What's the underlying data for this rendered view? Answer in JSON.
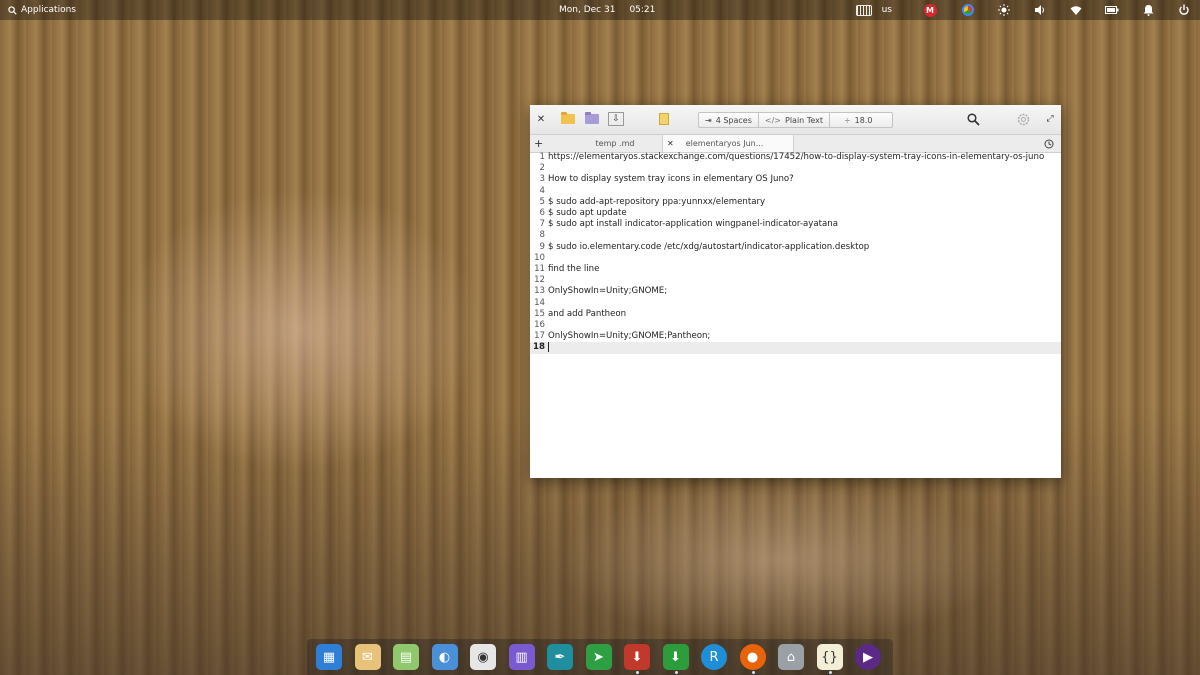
{
  "panel": {
    "applications_label": "Applications",
    "date": "Mon, Dec 31",
    "time": "05:21",
    "keyboard_layout": "us",
    "tray_icons": [
      "keyboard-icon",
      "mega-icon",
      "chrome-icon",
      "brightness-icon",
      "volume-icon",
      "wifi-icon",
      "battery-icon",
      "notifications-icon",
      "power-icon"
    ],
    "mega_letter": "M"
  },
  "editor": {
    "toolbar": {
      "indent_label": "4 Spaces",
      "language_label": "Plain Text",
      "font_size": "18.0"
    },
    "tabs": [
      {
        "label": "temp .md"
      },
      {
        "label": "elementaryos Jun..."
      }
    ],
    "current_line": "18",
    "lines": [
      {
        "n": "1",
        "text": "https://elementaryos.stackexchange.com/questions/17452/how-to-display-system-tray-icons-in-elementary-os-juno"
      },
      {
        "n": "2",
        "text": ""
      },
      {
        "n": "3",
        "text": "How to display system tray icons in elementary OS Juno?"
      },
      {
        "n": "4",
        "text": ""
      },
      {
        "n": "5",
        "text": "$ sudo add-apt-repository ppa:yunnxx/elementary"
      },
      {
        "n": "6",
        "text": "$ sudo apt update"
      },
      {
        "n": "7",
        "text": "$ sudo apt install indicator-application wingpanel-indicator-ayatana"
      },
      {
        "n": "8",
        "text": ""
      },
      {
        "n": "9",
        "text": "$ sudo io.elementary.code /etc/xdg/autostart/indicator-application.desktop"
      },
      {
        "n": "10",
        "text": ""
      },
      {
        "n": "11",
        "text": "find the line"
      },
      {
        "n": "12",
        "text": ""
      },
      {
        "n": "13",
        "text": "OnlyShowIn=Unity;GNOME;"
      },
      {
        "n": "14",
        "text": ""
      },
      {
        "n": "15",
        "text": "and add Pantheon"
      },
      {
        "n": "16",
        "text": ""
      },
      {
        "n": "17",
        "text": "OnlyShowIn=Unity;GNOME;Pantheon;"
      }
    ]
  },
  "dock": {
    "apps": [
      {
        "name": "multitasking-view-icon",
        "color": "#2f7fd6",
        "running": false
      },
      {
        "name": "mail-icon",
        "color": "#e9c27a",
        "running": false
      },
      {
        "name": "calendar-icon",
        "color": "#8fc96b",
        "running": false
      },
      {
        "name": "settings-toggle-icon",
        "color": "#4a90d9",
        "running": false
      },
      {
        "name": "music-player-icon",
        "color": "#e6e6e6",
        "running": false
      },
      {
        "name": "appcenter-icon",
        "color": "#7a5ad0",
        "running": false
      },
      {
        "name": "pen-tool-icon",
        "color": "#1f8fa0",
        "running": false
      },
      {
        "name": "send-app-icon",
        "color": "#2ea043",
        "running": false
      },
      {
        "name": "package-installer-icon",
        "color": "#c0392b",
        "running": true
      },
      {
        "name": "downloader-icon",
        "color": "#2d9c3a",
        "running": true
      },
      {
        "name": "remmina-icon",
        "color": "#1e8fd6",
        "running": false
      },
      {
        "name": "firefox-icon",
        "color": "#e8630a",
        "running": true
      },
      {
        "name": "files-icon",
        "color": "#9aa0a6",
        "running": false
      },
      {
        "name": "code-editor-icon",
        "color": "#f3efd6",
        "running": true
      },
      {
        "name": "video-player-icon",
        "color": "#5b2a86",
        "running": false
      }
    ]
  }
}
